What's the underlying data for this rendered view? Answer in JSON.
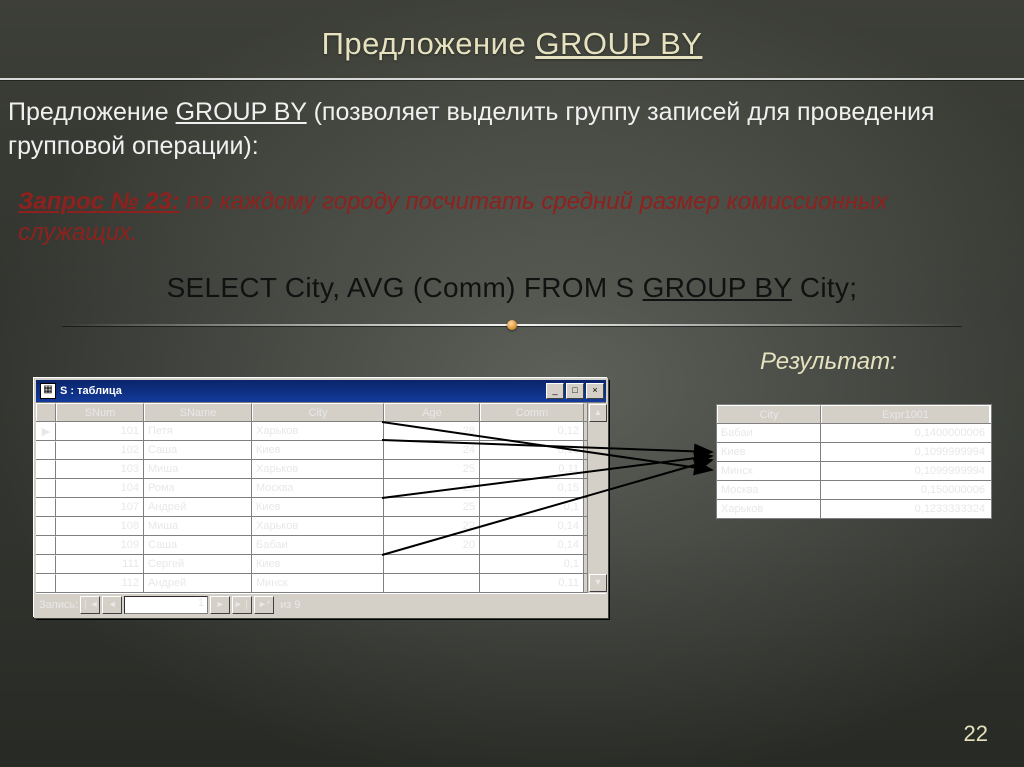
{
  "title_a": "Предложение ",
  "title_b": "GROUP BY",
  "intro_a": "Предложение ",
  "intro_b": "GROUP BY",
  "intro_c": " (позволяет выделить группу записей для проведения групповой операции):",
  "query_label": "Запрос № 23:",
  "query_text": "  по каждому городу посчитать средний размер комиссионных служащих.",
  "sql_a": "SELECT City, AVG (Comm) FROM  S ",
  "sql_b": "GROUP BY",
  "sql_c": " City;",
  "result_label": "Результат:",
  "page_number": "22",
  "source": {
    "window_title": "S : таблица",
    "icon_glyph": "▦",
    "headers": [
      "SNum",
      "SName",
      "City",
      "Age",
      "Comm"
    ],
    "rows": [
      {
        "snum": "101",
        "sname": "Петя",
        "city": "Харьков",
        "age": "28",
        "comm": "0,12"
      },
      {
        "snum": "102",
        "sname": "Саша",
        "city": "Киев",
        "age": "24",
        "comm": "0,13"
      },
      {
        "snum": "103",
        "sname": "Миша",
        "city": "Харьков",
        "age": "25",
        "comm": "0,11"
      },
      {
        "snum": "104",
        "sname": "Рома",
        "city": "Москва",
        "age": "20",
        "comm": "0,15"
      },
      {
        "snum": "107",
        "sname": "Андрей",
        "city": "Киев",
        "age": "25",
        "comm": "0,1"
      },
      {
        "snum": "108",
        "sname": "Миша",
        "city": "Харьков",
        "age": "22",
        "comm": "0,14"
      },
      {
        "snum": "109",
        "sname": "Саша",
        "city": "Бабаи",
        "age": "20",
        "comm": "0,14"
      },
      {
        "snum": "111",
        "sname": "Сергей",
        "city": "Киев",
        "age": "",
        "comm": "0,1"
      },
      {
        "snum": "112",
        "sname": "Андрей",
        "city": "Минск",
        "age": "",
        "comm": "0,11"
      }
    ],
    "nav": {
      "label": "Запись:",
      "current": "1",
      "of_label": "из",
      "of_total": "9"
    },
    "btn_first": "❘◄",
    "btn_prev": "◄",
    "btn_next": "►",
    "btn_last": "►❘",
    "btn_new": "►*",
    "sys_min": "_",
    "sys_max": "□",
    "sys_close": "×",
    "row_marker": "▶",
    "scroll_up": "▲",
    "scroll_down": "▼"
  },
  "result": {
    "headers": [
      "City",
      "Expr1001"
    ],
    "rows": [
      {
        "city": "Бабаи",
        "expr": "0,1400000006"
      },
      {
        "city": "Киев",
        "expr": "0,1099999994"
      },
      {
        "city": "Минск",
        "expr": "0,1099999994"
      },
      {
        "city": "Москва",
        "expr": "0,150000006"
      },
      {
        "city": "Харьков",
        "expr": "0,1233333324"
      }
    ]
  }
}
